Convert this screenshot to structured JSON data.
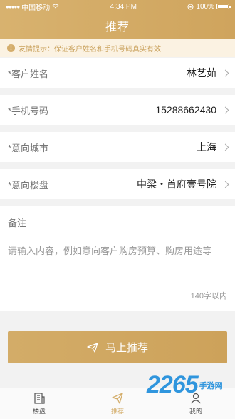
{
  "status_bar": {
    "carrier": "中国移动",
    "time": "4:34 PM",
    "battery": "100%"
  },
  "header": {
    "title": "推荐"
  },
  "tip": {
    "text": "友情提示：保证客户姓名和手机号码真实有效"
  },
  "form": {
    "name": {
      "label": "*客户姓名",
      "value": "林艺茹"
    },
    "phone": {
      "label": "*手机号码",
      "value": "15288662430"
    },
    "city": {
      "label": "*意向城市",
      "value": "上海"
    },
    "property": {
      "label": "*意向楼盘",
      "value": "中梁・首府壹号院"
    },
    "remark": {
      "label": "备注",
      "placeholder": "请输入内容，例如意向客户购房预算、购房用途等",
      "count": "140字以内"
    }
  },
  "submit": {
    "label": "马上推荐"
  },
  "tabs": [
    {
      "label": "楼盘",
      "icon": "building-icon"
    },
    {
      "label": "推荐",
      "icon": "paper-plane-icon"
    },
    {
      "label": "我的",
      "icon": "user-icon"
    }
  ],
  "watermark": {
    "number": "2265",
    "text": "手游网"
  },
  "colors": {
    "accent": "#cfa45d",
    "tip_bg": "#fbf2e2",
    "watermark": "#1f8edc"
  }
}
